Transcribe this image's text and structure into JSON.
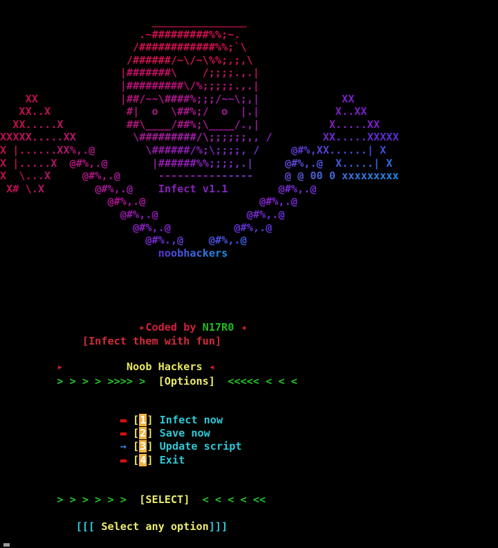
{
  "terminal": {
    "background": "#000000",
    "cursor_color": "#9a9a9a"
  },
  "banner": {
    "name": "infect-skull-ascii-art",
    "inline_title": "Infect v1.1",
    "signature": "noobhackers",
    "gradient": {
      "left": "#e01050",
      "mid": "#9b1fd0",
      "right": "#2090e8"
    },
    "rows": [
      {
        "text": "                        _______________",
        "colors": [
          "#b01048"
        ]
      },
      {
        "text": "                      .~#########%%;~.",
        "colors": [
          "#cc1050"
        ]
      },
      {
        "text": "                     /############%%;`\\",
        "colors": [
          "#cc1050"
        ]
      },
      {
        "text": "                    /######/~\\/~\\%%;,;,\\",
        "colors": [
          "#cc1050"
        ]
      },
      {
        "text": "                   |#######\\    /;;;;.,.|",
        "colors": [
          "#c01062"
        ]
      },
      {
        "text": "                   |#########\\/%;;;;;.,.|",
        "colors": [
          "#b81078"
        ]
      },
      {
        "text": "    XX             |##/~~\\####%;;;/~~\\;,|             XX",
        "colors": [
          "#c01050",
          "#a81890",
          "#7a20c8"
        ]
      },
      {
        "text": "   XX..X            #|  o  \\##%;/  o  |.|            X..XX",
        "colors": [
          "#c01050",
          "#a81890",
          "#7a20c8"
        ]
      },
      {
        "text": "  XX.....X          ##\\____/##%;\\____/.,|           X.....XX",
        "colors": [
          "#c01050",
          "#a81890",
          "#7a20c8"
        ]
      },
      {
        "text": "XXXXX.....XX         \\#########/\\;;;;;;,, /        XX.....XXXXX",
        "colors": [
          "#c01050",
          "#9a20a8",
          "#5a30d8"
        ]
      },
      {
        "text": "X |......XX%,.@        \\######/%;\\;;;;, /     @#%,XX......| X",
        "colors": [
          "#c01050",
          "#8a20b8",
          "#3a50e0"
        ]
      },
      {
        "text": "X |.....X  @#%,.@       |######%%;;;;,.|     @#%,.@  X.....| X",
        "colors": [
          "#c01050",
          "#8a20b8",
          "#2a70e8"
        ]
      },
      {
        "text": "X  \\...X     @#%,.@      ---------------     @ @ 00 0 xxxxxxxxx",
        "colors": [
          "#c01050",
          "#8a20b8",
          "#1f8ae8"
        ]
      },
      {
        "text": " X# \\.X        @#%,.@    Infect v1.1        @#%,.@",
        "colors": [
          "#c01050",
          "#8a20b8",
          "#7030d0"
        ]
      },
      {
        "text": "                 @#%,.@                  @#%,.@",
        "colors": [
          "#b01090",
          "#7a28d8"
        ]
      },
      {
        "text": "                   @#%,.@              @#%,.@",
        "colors": [
          "#9a18a8",
          "#6a30d8"
        ]
      },
      {
        "text": "                     @#%,.@          @#%,.@",
        "colors": [
          "#8a20c0",
          "#5a38d8"
        ]
      },
      {
        "text": "                       @#%.,@    @#%,.@",
        "colors": [
          "#7a28d0",
          "#3a60e0"
        ]
      },
      {
        "text": "                         noobhackers",
        "colors": [
          "#5a38d8",
          "#2090e0"
        ]
      }
    ]
  },
  "credits": {
    "name": "credits-block",
    "coded_by_arrow_left": "▸",
    "coded_by_text": "Coded by ",
    "coded_by_author": "N17R0",
    "coded_by_arrow_right": "◂",
    "group_arrow_left": "▸",
    "group_name": "Noob Hackers",
    "group_arrow_right": "◂",
    "tagline": "[Infect them with fun]",
    "author_color": "#22bb22",
    "group_color": "#e8e85c",
    "tagline_color": "#d02a3a"
  },
  "options_header": {
    "name": "options-section-header",
    "arrows_left": "> > > > >>>> >",
    "label": "[Options]",
    "arrows_right": "<<<<< < < <",
    "arrow_color": "#22c322",
    "label_color": "#ecec6e"
  },
  "menu": {
    "name": "main-menu",
    "bracket_open": "[",
    "bracket_close": "]",
    "bracket_color": "#e8e85c",
    "key_bg_color": "#f2b33d",
    "key_fg_color": "#ffffff",
    "label_color": "#2ec8d8",
    "bullet_square": "▬",
    "bullet_arrow": "→",
    "bullet_square_color": "#d81010",
    "bullet_arrow_color": "#3a7fe0",
    "items": [
      {
        "bullet": "square",
        "key": "1",
        "label": "Infect now"
      },
      {
        "bullet": "square",
        "key": "2",
        "label": "Save now"
      },
      {
        "bullet": "arrow",
        "key": "3",
        "label": "Update script"
      },
      {
        "bullet": "square",
        "key": "4",
        "label": "Exit"
      }
    ]
  },
  "select_footer": {
    "name": "select-section",
    "arrows_left": "> > > > > >",
    "label": "[SELECT]",
    "arrows_right": "< < < < <<",
    "arrow_color": "#22c322",
    "label_color": "#ecec6e",
    "prompt_open": "[[[",
    "prompt_text": " Select any option",
    "prompt_close": "]]]",
    "prompt_bracket_color": "#2ec8d8",
    "prompt_text_color": "#ecec6e"
  }
}
